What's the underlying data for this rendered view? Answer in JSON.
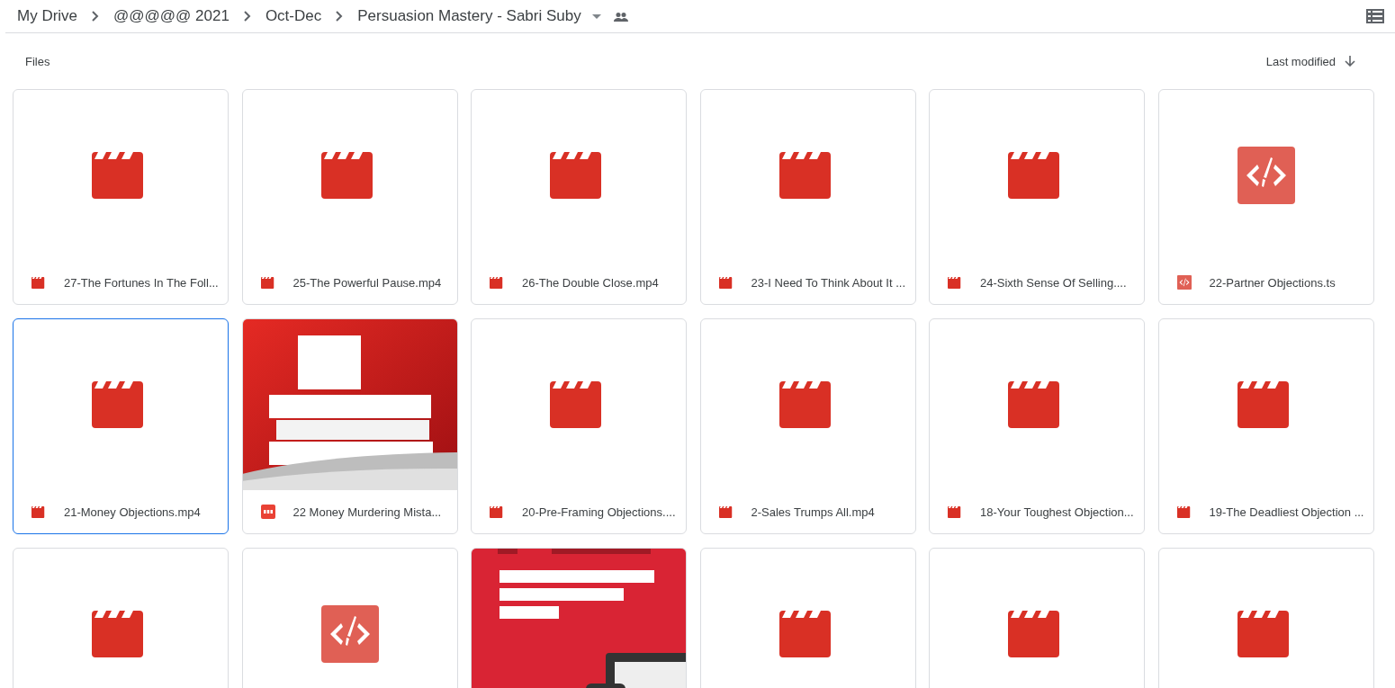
{
  "breadcrumbs": [
    {
      "label": "My Drive"
    },
    {
      "label": "@@@@@ 2021"
    },
    {
      "label": "Oct-Dec"
    },
    {
      "label": "Persuasion Mastery - Sabri Suby"
    }
  ],
  "section_title": "Files",
  "sort": {
    "label": "Last modified"
  },
  "files": [
    {
      "kind": "video",
      "name": "27-The Fortunes In The Foll...",
      "selected": false
    },
    {
      "kind": "video",
      "name": "25-The Powerful Pause.mp4",
      "selected": false
    },
    {
      "kind": "video",
      "name": "26-The Double Close.mp4",
      "selected": false
    },
    {
      "kind": "video",
      "name": "23-I Need To Think About It ...",
      "selected": false
    },
    {
      "kind": "video",
      "name": "24-Sixth Sense Of Selling....",
      "selected": false
    },
    {
      "kind": "code",
      "name": "22-Partner Objections.ts",
      "selected": false
    },
    {
      "kind": "video",
      "name": "21-Money Objections.mp4",
      "selected": true
    },
    {
      "kind": "pdf",
      "name": "22 Money Murdering Mista...",
      "selected": false
    },
    {
      "kind": "video",
      "name": "20-Pre-Framing Objections....",
      "selected": false
    },
    {
      "kind": "video",
      "name": "2-Sales Trumps All.mp4",
      "selected": false
    },
    {
      "kind": "video",
      "name": "18-Your Toughest Objection...",
      "selected": false
    },
    {
      "kind": "video",
      "name": "19-The Deadliest Objection ...",
      "selected": false
    },
    {
      "kind": "video",
      "selected": false
    },
    {
      "kind": "code",
      "selected": false
    },
    {
      "selected": false
    },
    {
      "kind": "video",
      "selected": false
    },
    {
      "kind": "video",
      "selected": false
    },
    {
      "kind": "video",
      "selected": false
    }
  ]
}
